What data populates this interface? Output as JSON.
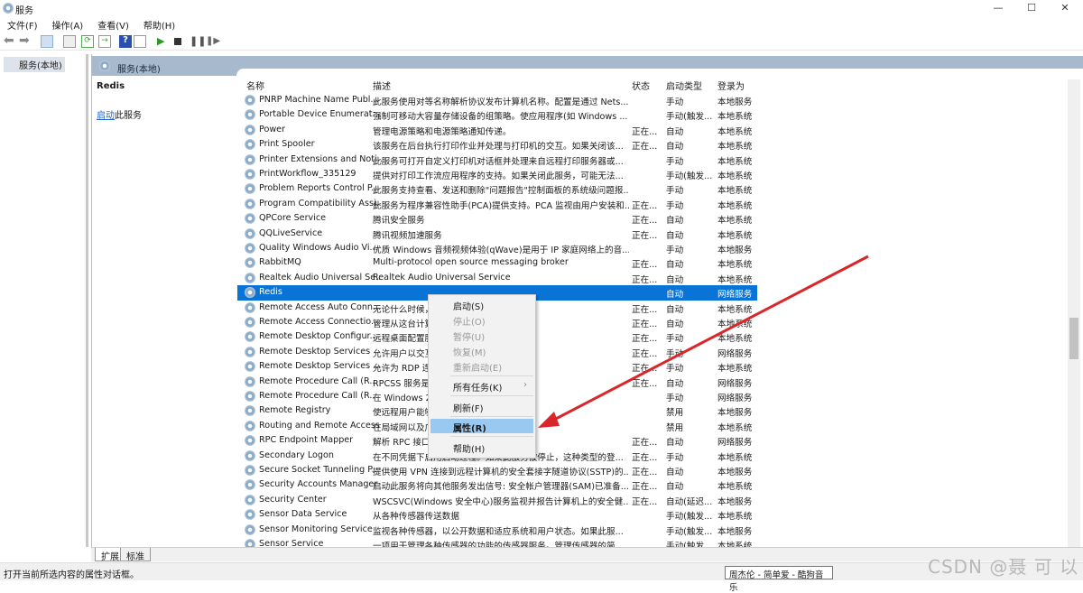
{
  "window": {
    "title": "服务",
    "minimize": "—",
    "maximize": "☐",
    "close": "✕"
  },
  "menubar": [
    "文件(F)",
    "操作(A)",
    "查看(V)",
    "帮助(H)"
  ],
  "tree": {
    "root": "服务(本地)"
  },
  "panel": {
    "header": "服务(本地)",
    "selected_service": "Redis",
    "start_link": "启动",
    "start_suffix": "此服务"
  },
  "columns": {
    "name": "名称",
    "desc": "描述",
    "status": "状态",
    "startup": "启动类型",
    "logon": "登录为"
  },
  "services": [
    {
      "name": "PNRP Machine Name Publ...",
      "desc": "此服务使用对等名称解析协议发布计算机名称。配置是通过 Nets...",
      "status": "",
      "startup": "手动",
      "logon": "本地服务"
    },
    {
      "name": "Portable Device Enumerat...",
      "desc": "强制可移动大容量存储设备的组策略。使应用程序(如 Windows ...",
      "status": "",
      "startup": "手动(触发...",
      "logon": "本地系统"
    },
    {
      "name": "Power",
      "desc": "管理电源策略和电源策略通知传递。",
      "status": "正在...",
      "startup": "自动",
      "logon": "本地系统"
    },
    {
      "name": "Print Spooler",
      "desc": "该服务在后台执行打印作业并处理与打印机的交互。如果关闭该...",
      "status": "正在...",
      "startup": "自动",
      "logon": "本地系统"
    },
    {
      "name": "Printer Extensions and Noti...",
      "desc": "此服务可打开自定义打印机对话框并处理来自远程打印服务器或...",
      "status": "",
      "startup": "手动",
      "logon": "本地系统"
    },
    {
      "name": "PrintWorkflow_335129",
      "desc": "提供对打印工作流应用程序的支持。如果关闭此服务，可能无法...",
      "status": "",
      "startup": "手动(触发...",
      "logon": "本地系统"
    },
    {
      "name": "Problem Reports Control P...",
      "desc": "此服务支持查看、发送和删除\"问题报告\"控制面板的系统级问题报...",
      "status": "",
      "startup": "手动",
      "logon": "本地系统"
    },
    {
      "name": "Program Compatibility Assi...",
      "desc": "此服务为程序兼容性助手(PCA)提供支持。PCA 监视由用户安装和...",
      "status": "正在...",
      "startup": "手动",
      "logon": "本地系统"
    },
    {
      "name": "QPCore Service",
      "desc": "腾讯安全服务",
      "status": "正在...",
      "startup": "自动",
      "logon": "本地系统"
    },
    {
      "name": "QQLiveService",
      "desc": "腾讯视频加速服务",
      "status": "正在...",
      "startup": "自动",
      "logon": "本地系统"
    },
    {
      "name": "Quality Windows Audio Vi...",
      "desc": "优质 Windows 音频视频体验(qWave)是用于 IP 家庭网络上的音...",
      "status": "",
      "startup": "手动",
      "logon": "本地服务"
    },
    {
      "name": "RabbitMQ",
      "desc": "Multi-protocol open source messaging broker",
      "status": "正在...",
      "startup": "自动",
      "logon": "本地系统"
    },
    {
      "name": "Realtek Audio Universal Se...",
      "desc": "Realtek Audio Universal Service",
      "status": "正在...",
      "startup": "自动",
      "logon": "本地系统"
    },
    {
      "name": "Redis",
      "desc": "",
      "status": "",
      "startup": "自动",
      "logon": "网络服务",
      "selected": true
    },
    {
      "name": "Remote Access Auto Conn...",
      "desc": "无论什么时候，                                    NS 或者 NetBIOS 名...",
      "status": "正在...",
      "startup": "自动",
      "logon": "本地系统"
    },
    {
      "name": "Remote Access Connectio...",
      "desc": "管理从这台计算                                    络的拨号和虚拟专用...",
      "status": "正在...",
      "startup": "自动",
      "logon": "本地系统"
    },
    {
      "name": "Remote Desktop Configur...",
      "desc": "远程桌面配置服                                    上下文的所有远程桌...",
      "status": "正在...",
      "startup": "手动",
      "logon": "本地系统"
    },
    {
      "name": "Remote Desktop Services",
      "desc": "允许用户以交互                                    程桌面和远程桌面会...",
      "status": "正在...",
      "startup": "手动",
      "logon": "网络服务"
    },
    {
      "name": "Remote Desktop Services ...",
      "desc": "允许为 RDP 连                                    口",
      "status": "正在...",
      "startup": "手动",
      "logon": "本地系统"
    },
    {
      "name": "Remote Procedure Call (R...",
      "desc": "RPCSS 服务是                                    务控制管理器。它执...",
      "status": "正在...",
      "startup": "自动",
      "logon": "网络服务"
    },
    {
      "name": "Remote Procedure Call (R...",
      "desc": "在 Windows 20                                    中，远程过程调用(RP...",
      "status": "",
      "startup": "手动",
      "logon": "网络服务"
    },
    {
      "name": "Remote Registry",
      "desc": "使远程用户能够                                    如果此服务被终止...",
      "status": "",
      "startup": "禁用",
      "logon": "本地服务"
    },
    {
      "name": "Routing and Remote Access",
      "desc": "在局域网以及广                                    服务。",
      "status": "",
      "startup": "禁用",
      "logon": "本地系统"
    },
    {
      "name": "RPC Endpoint Mapper",
      "desc": "解析 RPC 接口                                    务被停止或禁用，使...",
      "status": "正在...",
      "startup": "自动",
      "logon": "网络服务"
    },
    {
      "name": "Secondary Logon",
      "desc": "在不同凭据下启用启动过程。如果此服务被停止，这种类型的登...",
      "status": "正在...",
      "startup": "手动",
      "logon": "本地系统"
    },
    {
      "name": "Secure Socket Tunneling P...",
      "desc": "提供使用 VPN 连接到远程计算机的安全套接字隧道协议(SSTP)的...",
      "status": "正在...",
      "startup": "自动",
      "logon": "本地服务"
    },
    {
      "name": "Security Accounts Manager",
      "desc": "启动此服务将向其他服务发出信号: 安全帐户管理器(SAM)已准备...",
      "status": "正在...",
      "startup": "自动",
      "logon": "本地系统"
    },
    {
      "name": "Security Center",
      "desc": "WSCSVC(Windows 安全中心)服务监视并报告计算机上的安全健...",
      "status": "正在...",
      "startup": "自动(延迟...",
      "logon": "本地服务"
    },
    {
      "name": "Sensor Data Service",
      "desc": "从各种传感器传送数据",
      "status": "",
      "startup": "手动(触发...",
      "logon": "本地系统"
    },
    {
      "name": "Sensor Monitoring Service",
      "desc": "监视各种传感器，以公开数据和适应系统和用户状态。如果此服...",
      "status": "",
      "startup": "手动(触发...",
      "logon": "本地服务"
    },
    {
      "name": "Sensor Service",
      "desc": "一项用于管理各种传感器的功能的传感器服务。管理传感器的简...",
      "status": "",
      "startup": "手动(触发...",
      "logon": "本地系统"
    }
  ],
  "context_menu": [
    {
      "label": "启动(S)",
      "state": "enabled"
    },
    {
      "label": "停止(O)",
      "state": "disabled"
    },
    {
      "label": "暂停(U)",
      "state": "disabled"
    },
    {
      "label": "恢复(M)",
      "state": "disabled"
    },
    {
      "label": "重新启动(E)",
      "state": "disabled"
    },
    {
      "label": "所有任务(K)",
      "state": "submenu"
    },
    {
      "label": "刷新(F)",
      "state": "enabled"
    },
    {
      "label": "属性(R)",
      "state": "highlighted"
    },
    {
      "label": "帮助(H)",
      "state": "enabled"
    }
  ],
  "submenu_arrow": "›",
  "tabs": [
    "扩展",
    "标准"
  ],
  "statusbar": "打开当前所选内容的属性对话框。",
  "tooltip": "周杰伦 - 简单爱 - 酷狗音乐",
  "watermark": "CSDN @聂 可 以",
  "colors": {
    "selection": "#0a74d6",
    "menu_highlight": "#99c8f0",
    "annotation_arrow": "#d9262b",
    "band": "#a7b9cc"
  }
}
